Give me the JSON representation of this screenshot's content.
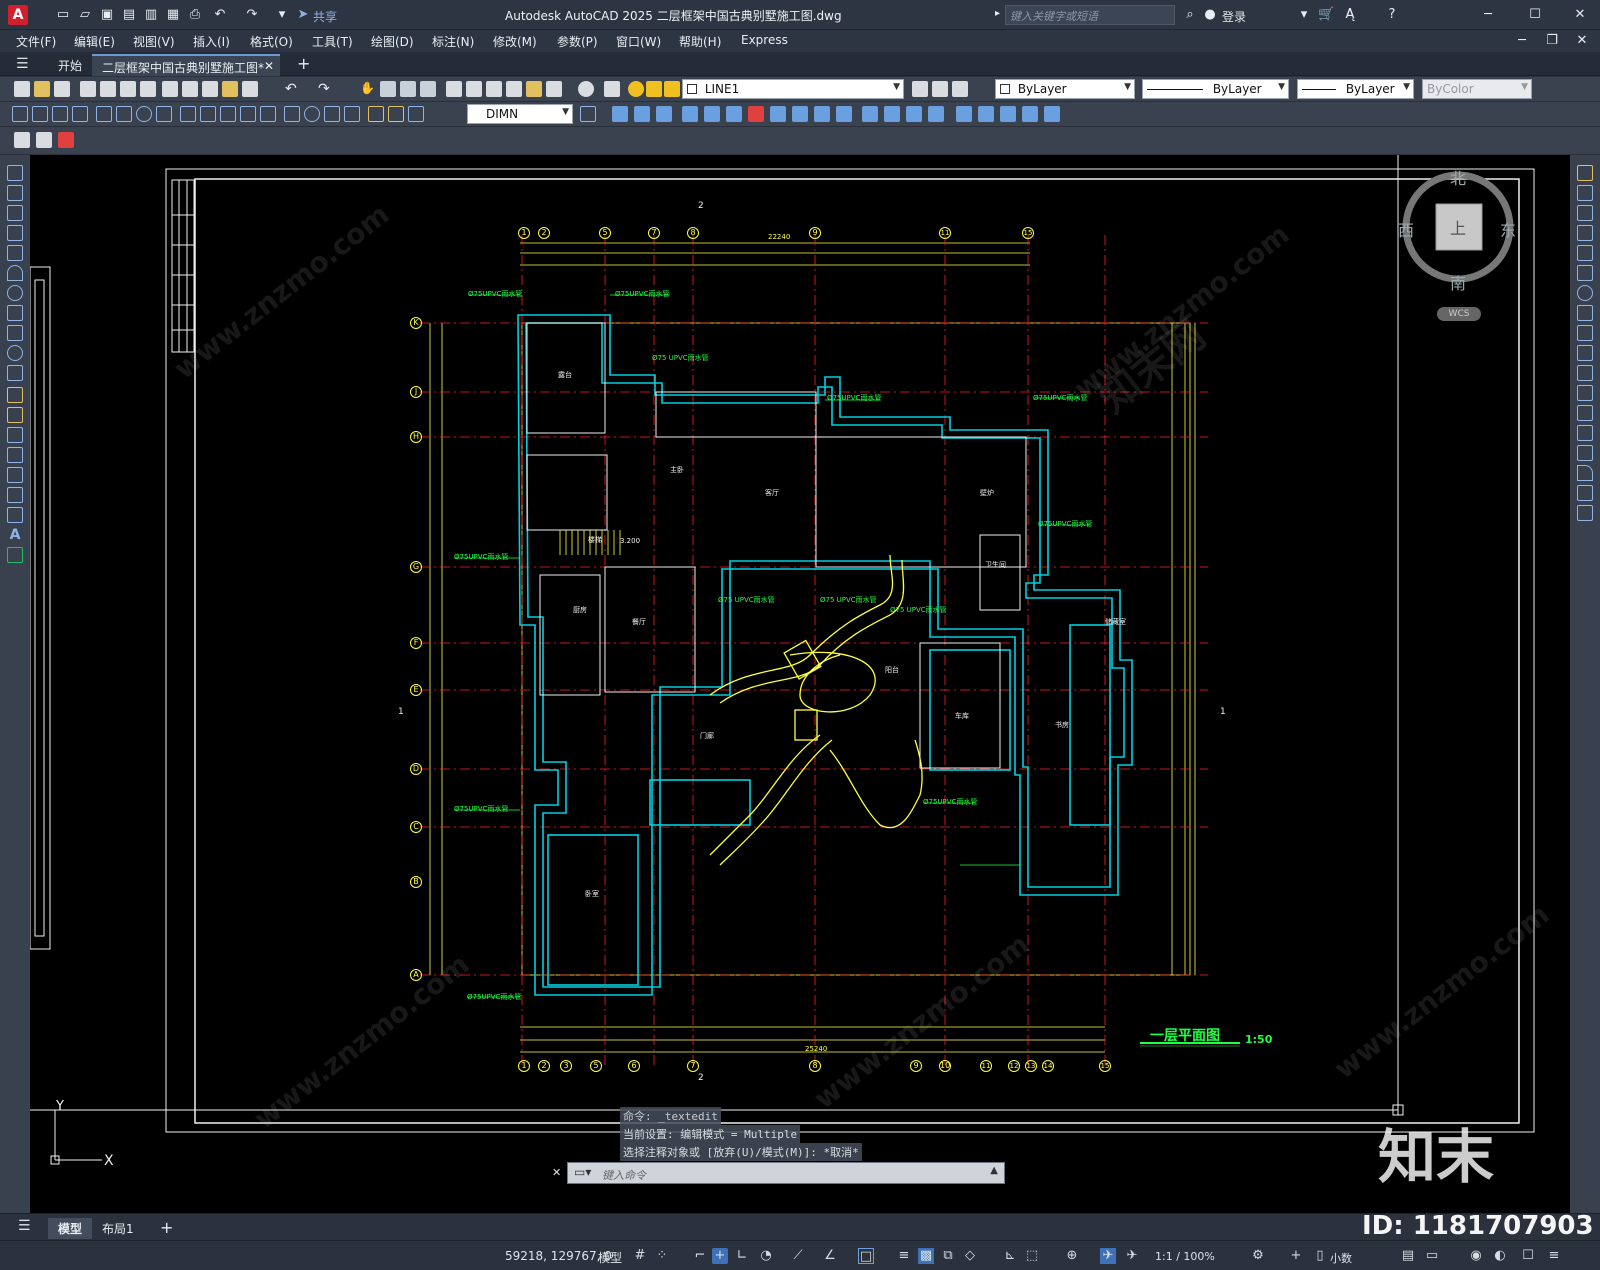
{
  "app": {
    "logo": "A",
    "title": "Autodesk AutoCAD 2025    二层框架中国古典别墅施工图.dwg",
    "search_placeholder": "键入关键字或短语",
    "login": "登录",
    "share": "共享"
  },
  "menu": [
    "文件(F)",
    "编辑(E)",
    "视图(V)",
    "插入(I)",
    "格式(O)",
    "工具(T)",
    "绘图(D)",
    "标注(N)",
    "修改(M)",
    "参数(P)",
    "窗口(W)",
    "帮助(H)",
    "Express"
  ],
  "tabs": {
    "start": "开始",
    "file": "二层框架中国古典别墅施工图*",
    "add": "+"
  },
  "toolbar": {
    "layer": "LINE1",
    "color": "ByLayer",
    "linetype": "ByLayer",
    "lineweight": "ByLayer",
    "plotstyle": "ByColor",
    "dimstyle": "DIMN"
  },
  "viewcube": {
    "north": "北",
    "south": "南",
    "east": "东",
    "west": "西",
    "top": "上",
    "wcs": "WCS"
  },
  "drawing": {
    "plan_title": "一层平面图",
    "scale": "1:50",
    "section_mark": "2",
    "side_mark": "1",
    "dim_total_top": "22240",
    "dim_total_bottom": "25240",
    "grid_top": [
      "1",
      "2",
      "5",
      "7",
      "8",
      "9",
      "11",
      "15"
    ],
    "grid_bottom": [
      "1",
      "2",
      "3",
      "5",
      "6",
      "7",
      "8",
      "9",
      "10",
      "11",
      "12",
      "13",
      "14",
      "15"
    ],
    "grid_left": [
      "K",
      "J",
      "H",
      "G",
      "F",
      "E",
      "D",
      "C",
      "B",
      "A"
    ],
    "rooms": [
      "客厅",
      "厨房",
      "餐厅",
      "卧室",
      "车库",
      "露台",
      "卫生间",
      "楼梯",
      "储藏室",
      "书房",
      "主卧",
      "门廊",
      "阳台",
      "壁炉"
    ],
    "pipe_note": "Ø75UPVC雨水管",
    "pipe_note2": "Ø75 UPVC雨水管",
    "stair_note": "3.200"
  },
  "command": {
    "line1": "命令: _textedit",
    "line2": "当前设置: 编辑模式 = Multiple",
    "line3": "选择注释对象或 [放弃(U)/模式(M)]: *取消*",
    "placeholder": "键入命令"
  },
  "layouts": {
    "model": "模型",
    "layout1": "布局1",
    "add": "+"
  },
  "status": {
    "coords": "59218, 129767, 0",
    "model": "模型",
    "scale": "1:1 / 100%",
    "units": "小数"
  },
  "watermark": {
    "brand": "知末",
    "id": "ID: 1181707903",
    "site": "www.znzmo.com",
    "site_cn": "知末网"
  },
  "colors": {
    "canvas": "#000000",
    "wall": "#00d0e0",
    "axis": "#ff2020",
    "dim": "#ffff40",
    "text": "#20ff40",
    "white": "#f0f0f0"
  }
}
